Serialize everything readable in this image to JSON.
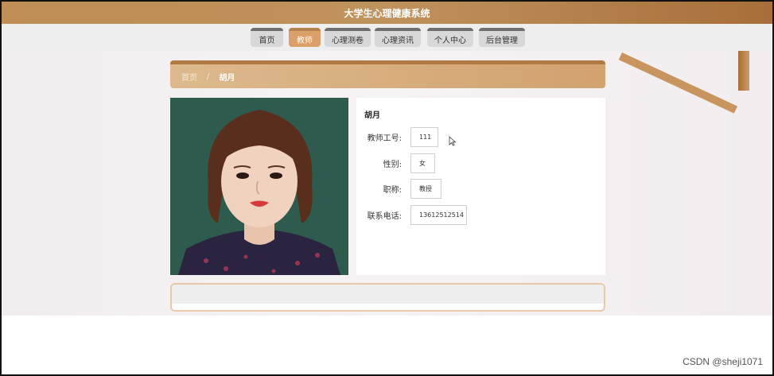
{
  "app": {
    "title": "大学生心理健康系统"
  },
  "nav": {
    "items": [
      {
        "label": "首页",
        "active": false
      },
      {
        "label": "教师",
        "active": true
      },
      {
        "label": "心理测卷",
        "active": false
      },
      {
        "label": "心理资讯",
        "active": false
      },
      {
        "label": "个人中心",
        "active": false
      },
      {
        "label": "后台管理",
        "active": false
      }
    ]
  },
  "breadcrumb": {
    "home": "首页",
    "separator": "/",
    "current": "胡月"
  },
  "teacher": {
    "name": "胡月",
    "fields": [
      {
        "label": "教师工号:",
        "value": "111"
      },
      {
        "label": "性别:",
        "value": "女"
      },
      {
        "label": "职称:",
        "value": "教授"
      },
      {
        "label": "联系电话:",
        "value": "13612512514"
      }
    ]
  },
  "watermark": "CSDN @sheji1071",
  "colors": {
    "accent": "#c0925d",
    "active_nav": "#d9a06a"
  }
}
